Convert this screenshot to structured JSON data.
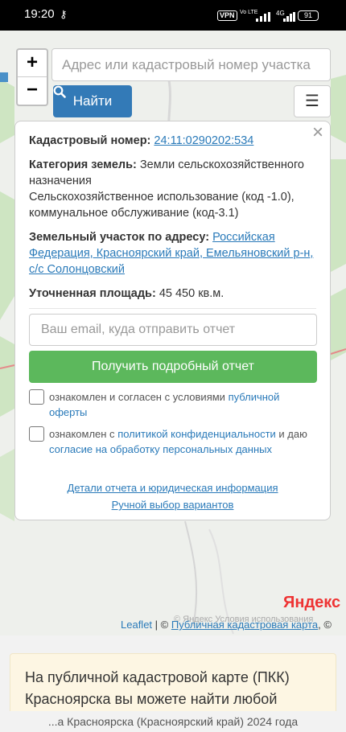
{
  "status_bar": {
    "time": "19:20",
    "vpn": "VPN",
    "lte": "Vo LTE",
    "network": "4G",
    "battery": "91"
  },
  "map": {
    "zoom_in": "+",
    "zoom_out": "−",
    "search_placeholder": "Адрес или кадастровый номер участка",
    "search_button": "Найти",
    "menu_icon": "menu-icon"
  },
  "popup": {
    "close": "×",
    "cadastral_label": "Кадастровый номер:",
    "cadastral_value": "24:11:0290202:534",
    "category_label": "Категория земель:",
    "category_value": "Земли сельскохозяйственного назначения",
    "usage_value": "Сельскохозяйственное использование (код -1.0), коммунальное обслуживание (код-3.1)",
    "address_label": "Земельный участок по адресу:",
    "address_value": "Российская Федерация, Красноярский край, Емельяновский р-н, с/с Солонцовский",
    "area_label": "Уточненная площадь:",
    "area_value": "45 450 кв.м.",
    "email_placeholder": "Ваш email, куда отправить отчет",
    "report_button": "Получить подробный отчет",
    "consent1_text": "ознакомлен и согласен с условиями ",
    "consent1_link": "публичной оферты",
    "consent2_text": "ознакомлен с ",
    "consent2_link": "политикой конфиденциальности",
    "consent2_mid": " и даю ",
    "consent2_link2": "согласие на обработку персональных данных",
    "link_details": "Детали отчета и юридическая информация",
    "link_manual": "Ручной выбор вариантов"
  },
  "attribution": {
    "yandex": "Яндекс",
    "terms": "© Яндекс  Условия использования",
    "leaflet": "Leaflet",
    "sep": " | © ",
    "pkk": "Публичная кадастровая карта",
    "tail": ", ©"
  },
  "info_text": "На публичной кадастровой карте (ПКК) Красноярска вы можете найти любой",
  "bottom_text": "...а Красноярска (Красноярский край) 2024 года"
}
